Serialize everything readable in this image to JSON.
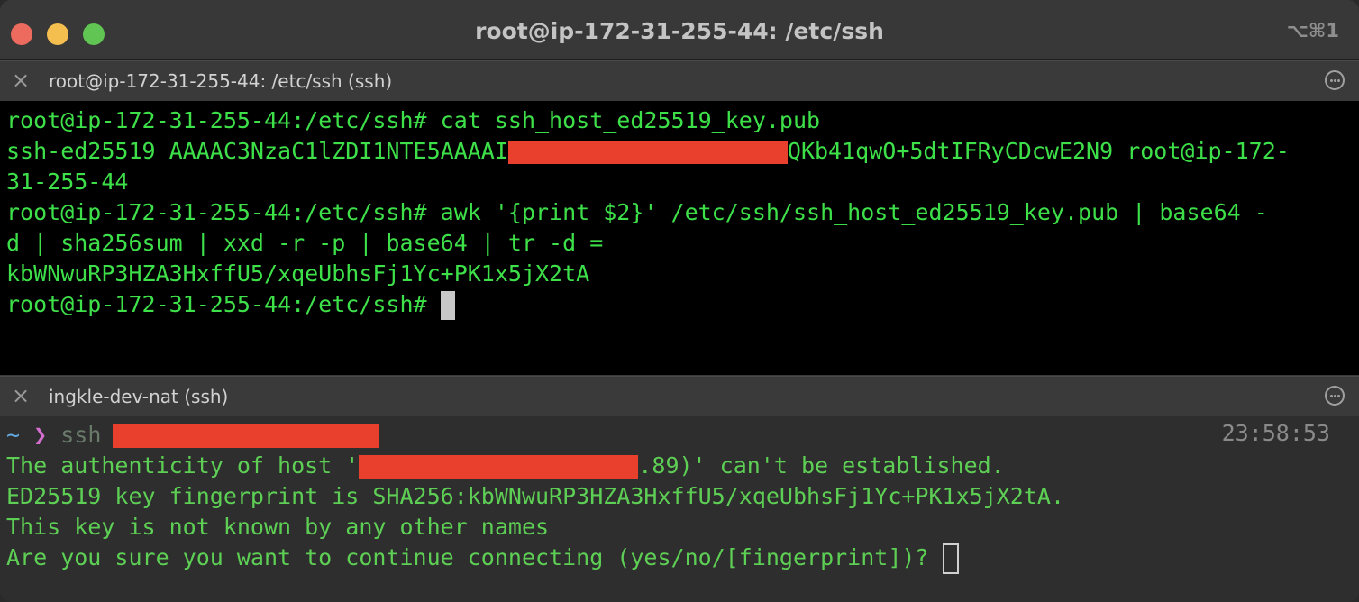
{
  "window": {
    "title": "root@ip-172-31-255-44: /etc/ssh",
    "shortcut": "⌥⌘1"
  },
  "panes": [
    {
      "title": "root@ip-172-31-255-44: /etc/ssh (ssh)",
      "lines": {
        "l1": "root@ip-172-31-255-44:/etc/ssh# cat ssh_host_ed25519_key.pub",
        "l2a": "ssh-ed25519 AAAAC3NzaC1lZDI1NTE5AAAAI",
        "l2b": "QKb41qwO+5dtIFRyCDcwE2N9 root@ip-172-",
        "l3": "31-255-44",
        "l4": "root@ip-172-31-255-44:/etc/ssh# awk '{print $2}' /etc/ssh/ssh_host_ed25519_key.pub | base64 -",
        "l5": "d | sha256sum | xxd -r -p | base64 | tr -d =",
        "l6": "kbWNwuRP3HZA3HxffU5/xqeUbhsFj1Yc+PK1x5jX2tA",
        "l7": "root@ip-172-31-255-44:/etc/ssh# "
      }
    },
    {
      "title": "ingkle-dev-nat (ssh)",
      "prompt": {
        "tilde": "~",
        "chevron": "❯",
        "command": "ssh i",
        "time": "23:58:53"
      },
      "lines": {
        "l1a": "The authenticity of host '",
        "l1b": ".89)' can't be established.",
        "l2": "ED25519 key fingerprint is SHA256:kbWNwuRP3HZA3HxffU5/xqeUbhsFj1Yc+PK1x5jX2tA.",
        "l3": "This key is not known by any other names",
        "l4": "Are you sure you want to continue connecting (yes/no/[fingerprint])? "
      }
    }
  ],
  "colors": {
    "terminal_green": "#3ee04a",
    "redaction": "#e8402c"
  }
}
